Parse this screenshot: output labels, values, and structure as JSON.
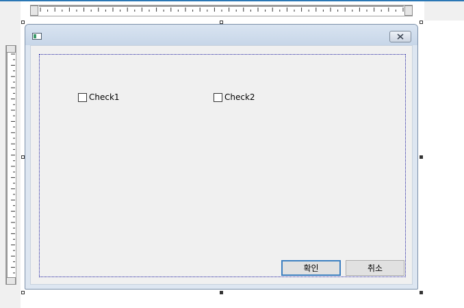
{
  "dialog": {
    "checkbox1": {
      "label": "Check1",
      "checked": false
    },
    "checkbox2": {
      "label": "Check2",
      "checked": false
    },
    "ok_button": {
      "label": "확인"
    },
    "cancel_button": {
      "label": "취소"
    }
  },
  "colors": {
    "title_bar": "#c7d6e8",
    "client_background": "#f0f0f0",
    "guide_border": "#2020a0",
    "default_button_border": "#3c7fc1"
  },
  "icons": {
    "app": "dialog-app-icon",
    "close": "close-icon"
  }
}
